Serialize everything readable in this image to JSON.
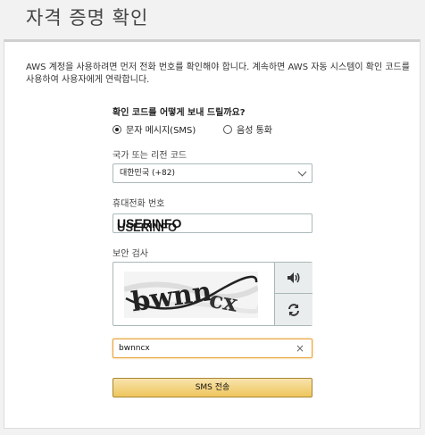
{
  "page": {
    "title": "자격 증명 확인"
  },
  "intro": {
    "text": "AWS 계정을 사용하려면 먼저 전화 번호를 확인해야 합니다. 계속하면 AWS 자동 시스템이 확인 코드를 사용하여 사용자에게 연락합니다."
  },
  "method": {
    "question": "확인 코드를 어떻게 보내 드릴까요?",
    "options": [
      {
        "label": "문자 메시지(SMS)",
        "selected": true
      },
      {
        "label": "음성 통화",
        "selected": false
      }
    ]
  },
  "country": {
    "label": "국가 또는 리전 코드",
    "value": "대한민국 (+82)"
  },
  "phone": {
    "label": "휴대전화 번호",
    "overlay": "USERINFO",
    "overlay_ghost": "USERINFO"
  },
  "security": {
    "label": "보안 검사",
    "captcha_text": "bwnncx",
    "audio_icon": "speaker-icon",
    "refresh_icon": "refresh-icon"
  },
  "captcha_input": {
    "value": "bwnncx",
    "clear_icon": "×"
  },
  "submit": {
    "label": "SMS 전송"
  },
  "colors": {
    "button_gradient_top": "#f8e3ad",
    "button_gradient_bottom": "#eec65c",
    "focus_border": "#e8a33d"
  }
}
